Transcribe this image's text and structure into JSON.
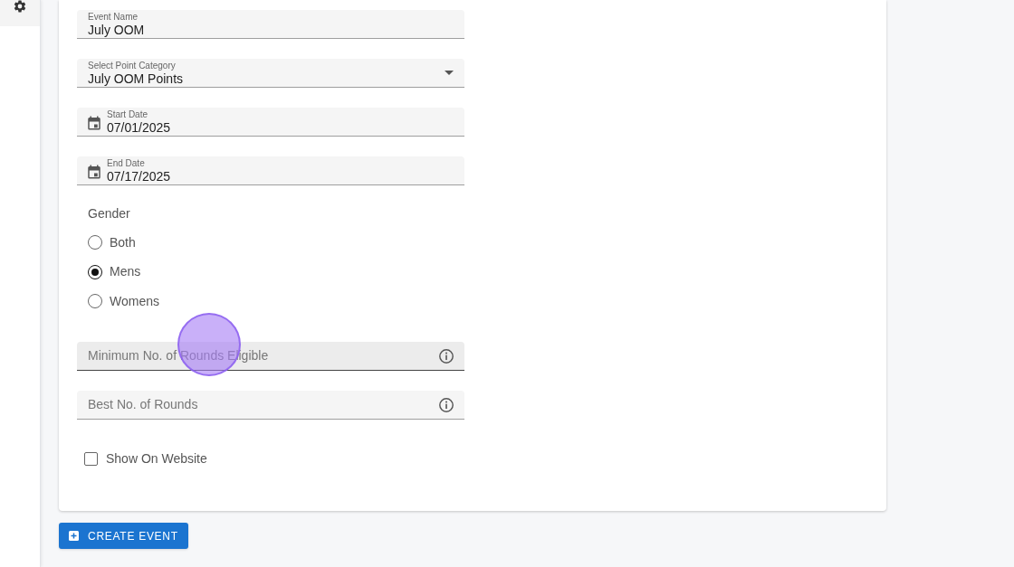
{
  "fields": [
    {
      "kind": "text",
      "label": "Event Name",
      "value": "July OOM"
    },
    {
      "kind": "select",
      "label": "Select Point Category",
      "value": "July OOM Points"
    },
    {
      "kind": "date",
      "label": "Start Date",
      "value": "07/01/2025"
    },
    {
      "kind": "date",
      "label": "End Date",
      "value": "07/17/2025"
    }
  ],
  "gender": {
    "label": "Gender",
    "options": [
      {
        "label": "Both",
        "selected": false
      },
      {
        "label": "Mens",
        "selected": true
      },
      {
        "label": "Womens",
        "selected": false
      }
    ]
  },
  "number_fields": [
    {
      "placeholder": "Minimum No. of Rounds Eligible",
      "focused": true
    },
    {
      "placeholder": "Best No. of Rounds",
      "focused": false
    }
  ],
  "show_on_website": {
    "label": "Show On Website",
    "checked": false
  },
  "create_button": {
    "label": "CREATE EVENT"
  }
}
